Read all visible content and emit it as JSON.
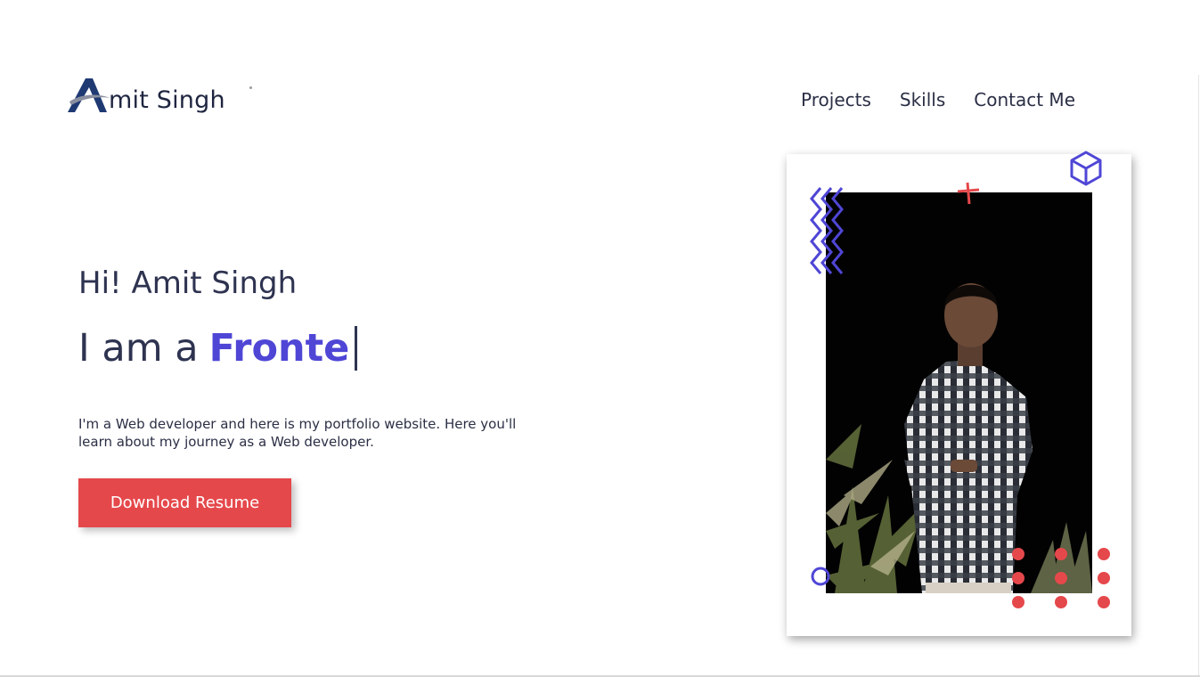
{
  "header": {
    "logo_initial": "A",
    "logo_text": "mit Singh",
    "nav": [
      {
        "label": "Projects"
      },
      {
        "label": "Skills"
      },
      {
        "label": "Contact Me"
      }
    ]
  },
  "hero": {
    "greeting": "Hi! Amit Singh",
    "role_prefix": "I am a",
    "role_typed": "Fronte",
    "description": "I'm a Web developer and here is my portfolio website. Here you'll learn about my journey as a Web developer.",
    "download_label": "Download Resume"
  },
  "photo": {
    "alt": "Amit Singh standing with arms crossed at night"
  },
  "colors": {
    "accent": "#4f46d6",
    "button": "#e5484b",
    "text": "#2e3350",
    "logo_navy": "#1f3a73"
  },
  "icons": [
    "logo-mark-icon",
    "zigzag-icon",
    "plus-icon",
    "cube-icon",
    "ring-icon",
    "dot-grid-icon"
  ]
}
